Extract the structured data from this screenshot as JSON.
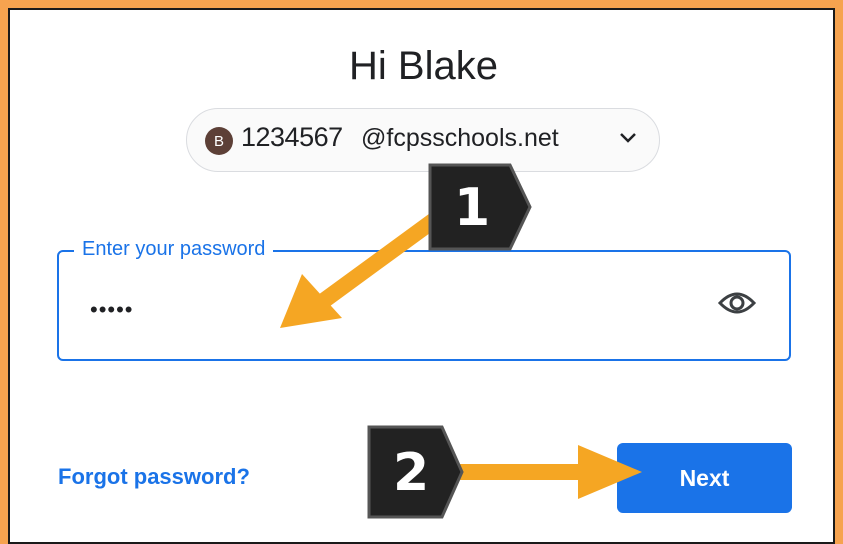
{
  "header": {
    "title": "Hi Blake"
  },
  "account": {
    "avatar_letter": "B",
    "id": "1234567",
    "domain": "@fcpsschools.net",
    "chevron_icon": "chevron-down-icon"
  },
  "password": {
    "label": "Enter your password",
    "value": "•••••",
    "toggle_icon": "eye-icon"
  },
  "actions": {
    "forgot_label": "Forgot password?",
    "next_label": "Next"
  },
  "annotations": {
    "step1": "1",
    "step2": "2",
    "arrow_color": "#f5a623",
    "badge_color": "#222222"
  },
  "colors": {
    "accent": "#1a73e8",
    "frame_border": "#f6a34f"
  }
}
